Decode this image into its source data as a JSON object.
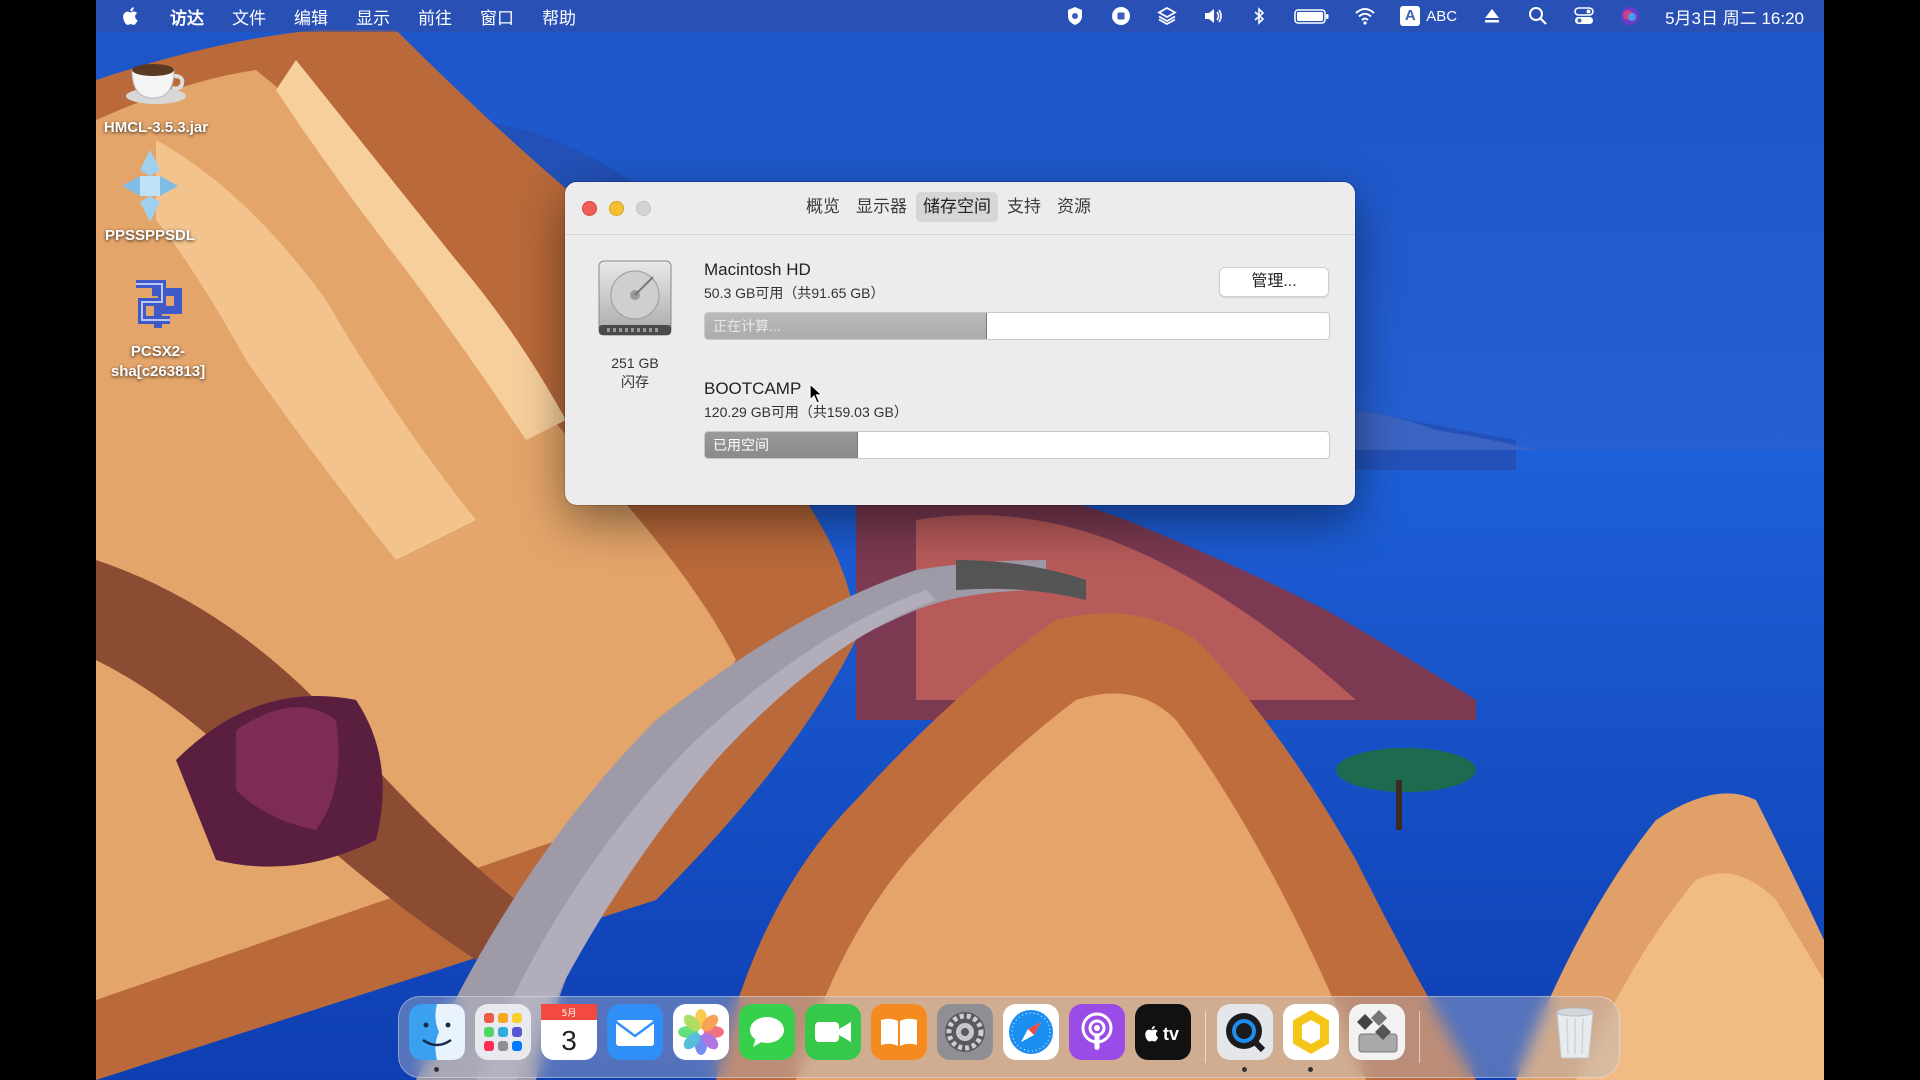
{
  "menubar": {
    "menus": [
      "访达",
      "文件",
      "编辑",
      "显示",
      "前往",
      "窗口",
      "帮助"
    ],
    "status_icons": [
      "shield-icon",
      "record-stop-icon",
      "layers-icon",
      "volume-icon",
      "bluetooth-icon",
      "battery-icon",
      "wifi-icon",
      "input-source-icon",
      "eject-icon",
      "search-icon",
      "control-center-icon",
      "siri-icon"
    ],
    "input_source_letter": "A",
    "input_source_label": "ABC",
    "datetime": "5月3日 周二  16:20"
  },
  "desktop": {
    "items": [
      {
        "label": "HMCL-3.5.3.jar",
        "icon": "java-coffee-icon"
      },
      {
        "label": "PPSSPPSDL",
        "icon": "ppsspp-icon"
      },
      {
        "label_line1": "PCSX2-",
        "label_line2": "sha[c263813]",
        "icon": "pcsx2-icon"
      }
    ]
  },
  "window": {
    "tabs": [
      "概览",
      "显示器",
      "储存空间",
      "支持",
      "资源"
    ],
    "active_tab": "储存空间",
    "drive": {
      "capacity": "251 GB",
      "type": "闪存",
      "icon": "hard-drive-icon"
    },
    "manage_button": "管理...",
    "volumes": [
      {
        "name": "Macintosh HD",
        "info": "50.3 GB可用（共91.65 GB）",
        "bar_label": "正在计算...",
        "used_fraction": 0.45
      },
      {
        "name": "BOOTCAMP",
        "info": "120.29 GB可用（共159.03 GB）",
        "bar_label": "已用空间",
        "used_fraction": 0.244
      }
    ]
  },
  "dock": {
    "apps": [
      "finder-icon",
      "launchpad-icon",
      "calendar-icon",
      "mail-icon",
      "photos-icon",
      "messages-icon",
      "facetime-icon",
      "books-icon",
      "system-preferences-icon",
      "safari-icon",
      "podcasts-icon",
      "apple-tv-icon",
      "quicktime-icon",
      "hexagon-app-icon",
      "boot-camp-icon",
      "trash-icon"
    ],
    "calendar_month": "5月",
    "calendar_day": "3",
    "tv_label": "tv"
  }
}
